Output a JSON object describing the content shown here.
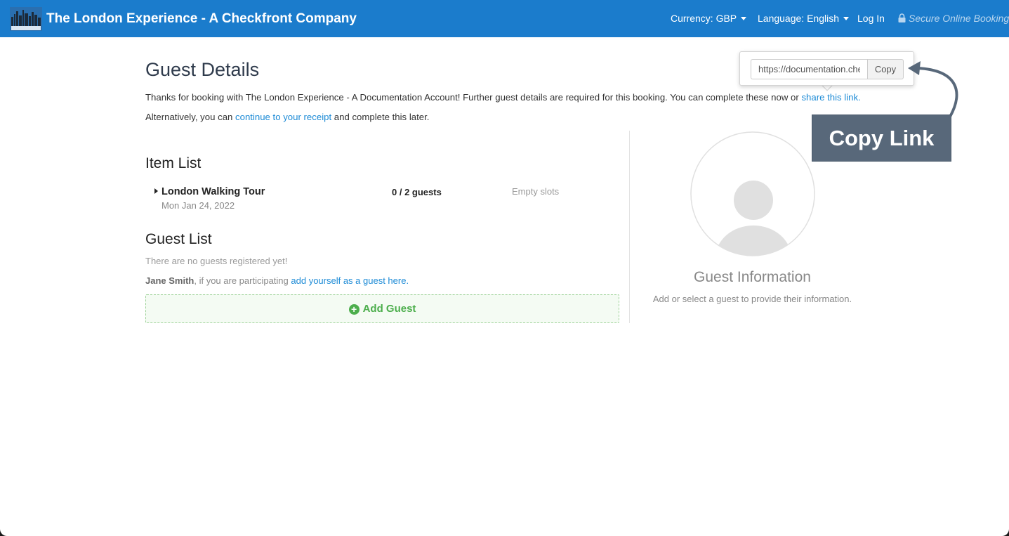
{
  "navbar": {
    "brand": "The London Experience - A Checkfront Company",
    "currency": "Currency: GBP",
    "language": "Language: English",
    "login": "Log In",
    "secure": "Secure Online Booking"
  },
  "page": {
    "title": "Guest Details",
    "intro_text": "Thanks for booking with The London Experience - A Documentation Account! Further guest details are required for this booking. You can complete these now or ",
    "share_link": "share this link.",
    "alt_prefix": "Alternatively, you can ",
    "receipt_link": "continue to your receipt",
    "alt_suffix": " and complete this later."
  },
  "item_list": {
    "title": "Item List",
    "items": [
      {
        "name": "London Walking Tour",
        "date": "Mon Jan 24, 2022",
        "guests": "0 / 2 guests",
        "slots": "Empty slots"
      }
    ]
  },
  "guest_list": {
    "title": "Guest List",
    "empty_text": "There are no guests registered yet!",
    "user_name": "Jane Smith",
    "participate_text": ", if you are participating ",
    "add_self_link": "add yourself as a guest here.",
    "add_button": "Add Guest"
  },
  "guest_info": {
    "title": "Guest Information",
    "subtitle": "Add or select a guest to provide their information."
  },
  "share_popover": {
    "url": "https://documentation.checkfront.com",
    "copy_label": "Copy"
  },
  "annotation": {
    "label": "Copy Link"
  },
  "colors": {
    "navbar": "#1b7ccc",
    "link": "#1b8ad6",
    "success": "#4cae4c",
    "callout": "#58687a"
  }
}
